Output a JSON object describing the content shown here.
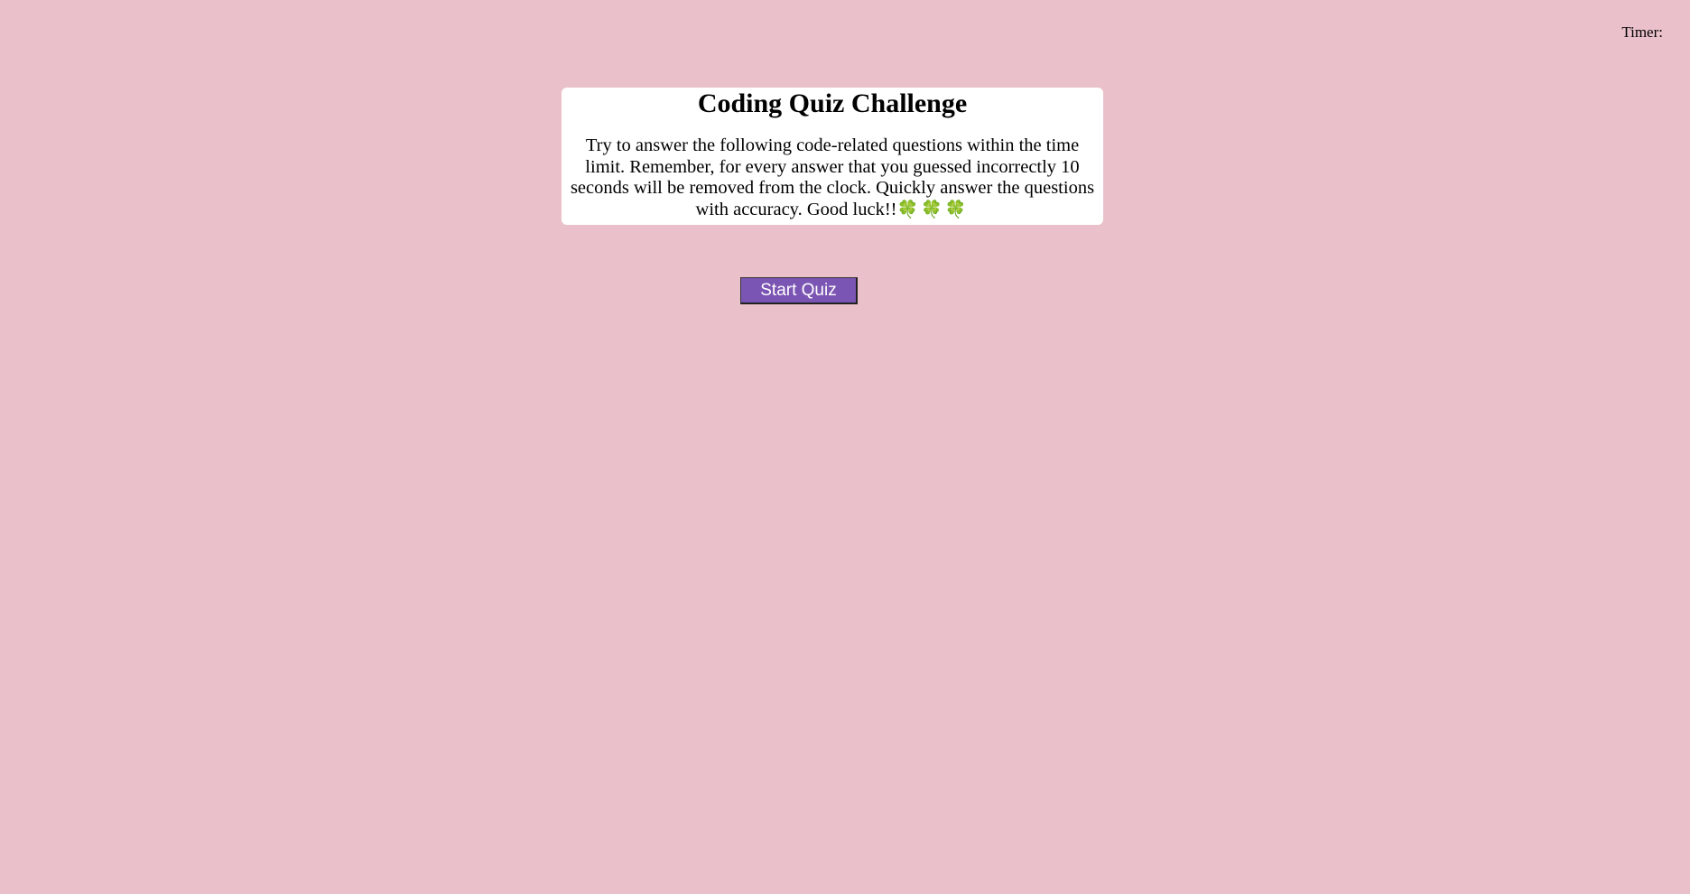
{
  "header": {
    "timer_label": "Timer:"
  },
  "intro": {
    "title": "Coding Quiz Challenge",
    "description": "Try to answer the following code-related questions within the time limit. Remember, for every answer that you guessed incorrectly 10 seconds will be removed from the clock. Quickly answer the questions with accuracy. Good luck!!",
    "clovers": "🍀🍀🍀"
  },
  "actions": {
    "start_label": "Start Quiz"
  },
  "colors": {
    "background": "#eac1ca",
    "card": "#ffffff",
    "button": "#7b55b3",
    "clover": "#3f9a2f"
  }
}
